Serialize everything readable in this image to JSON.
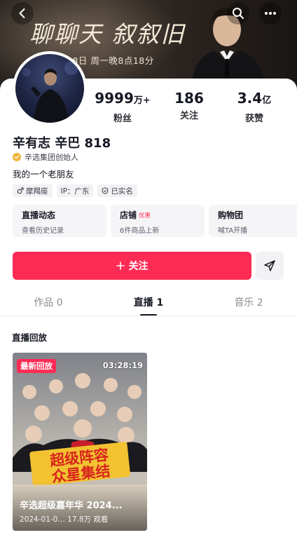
{
  "cover": {
    "title": "聊聊天 叙叙旧",
    "subtitle": "月18日 周一晚8点18分"
  },
  "nav": {
    "back_icon": "chevron-left-icon",
    "search_icon": "search-icon",
    "more_icon": "more-icon"
  },
  "profile": {
    "stats": {
      "fans_value": "9999",
      "fans_unit": "万+",
      "fans_label": "粉丝",
      "following_value": "186",
      "following_label": "关注",
      "likes_value": "3.4",
      "likes_unit": "亿",
      "likes_label": "获赞"
    },
    "nickname": "辛有志 辛巴 818",
    "verified_title": "辛选集团创始人",
    "bio": "我的一个老朋友",
    "tags": {
      "zodiac": "摩羯座",
      "ip": "IP：广东",
      "real_name": "已实名"
    }
  },
  "cards": [
    {
      "title": "直播动态",
      "badge": "",
      "subtitle": "查看历史记录"
    },
    {
      "title": "店铺",
      "badge": "优惠",
      "subtitle": "6件商品上新"
    },
    {
      "title": "购物团",
      "badge": "",
      "subtitle": "喊TA开播"
    }
  ],
  "actions": {
    "follow_label": "关注",
    "follow_icon": "plus-icon",
    "share_icon": "send-icon"
  },
  "tabs": {
    "works": "作品 0",
    "live": "直播 1",
    "music": "音乐 2",
    "active": "live"
  },
  "section": {
    "title": "直播回放"
  },
  "replay": {
    "badge": "最新回放",
    "duration": "03:28:19",
    "poster_line1": "超级阵容",
    "poster_line2": "众星集结",
    "title": "辛选超级嘉年华 2024...",
    "meta": "2024-01-0… 17.8万 观看"
  },
  "colors": {
    "accent": "#fe2c55",
    "text": "#161823",
    "muted": "#8a8b91",
    "card_bg": "#f5f5f7",
    "verify_gold": "#f0b43a"
  }
}
